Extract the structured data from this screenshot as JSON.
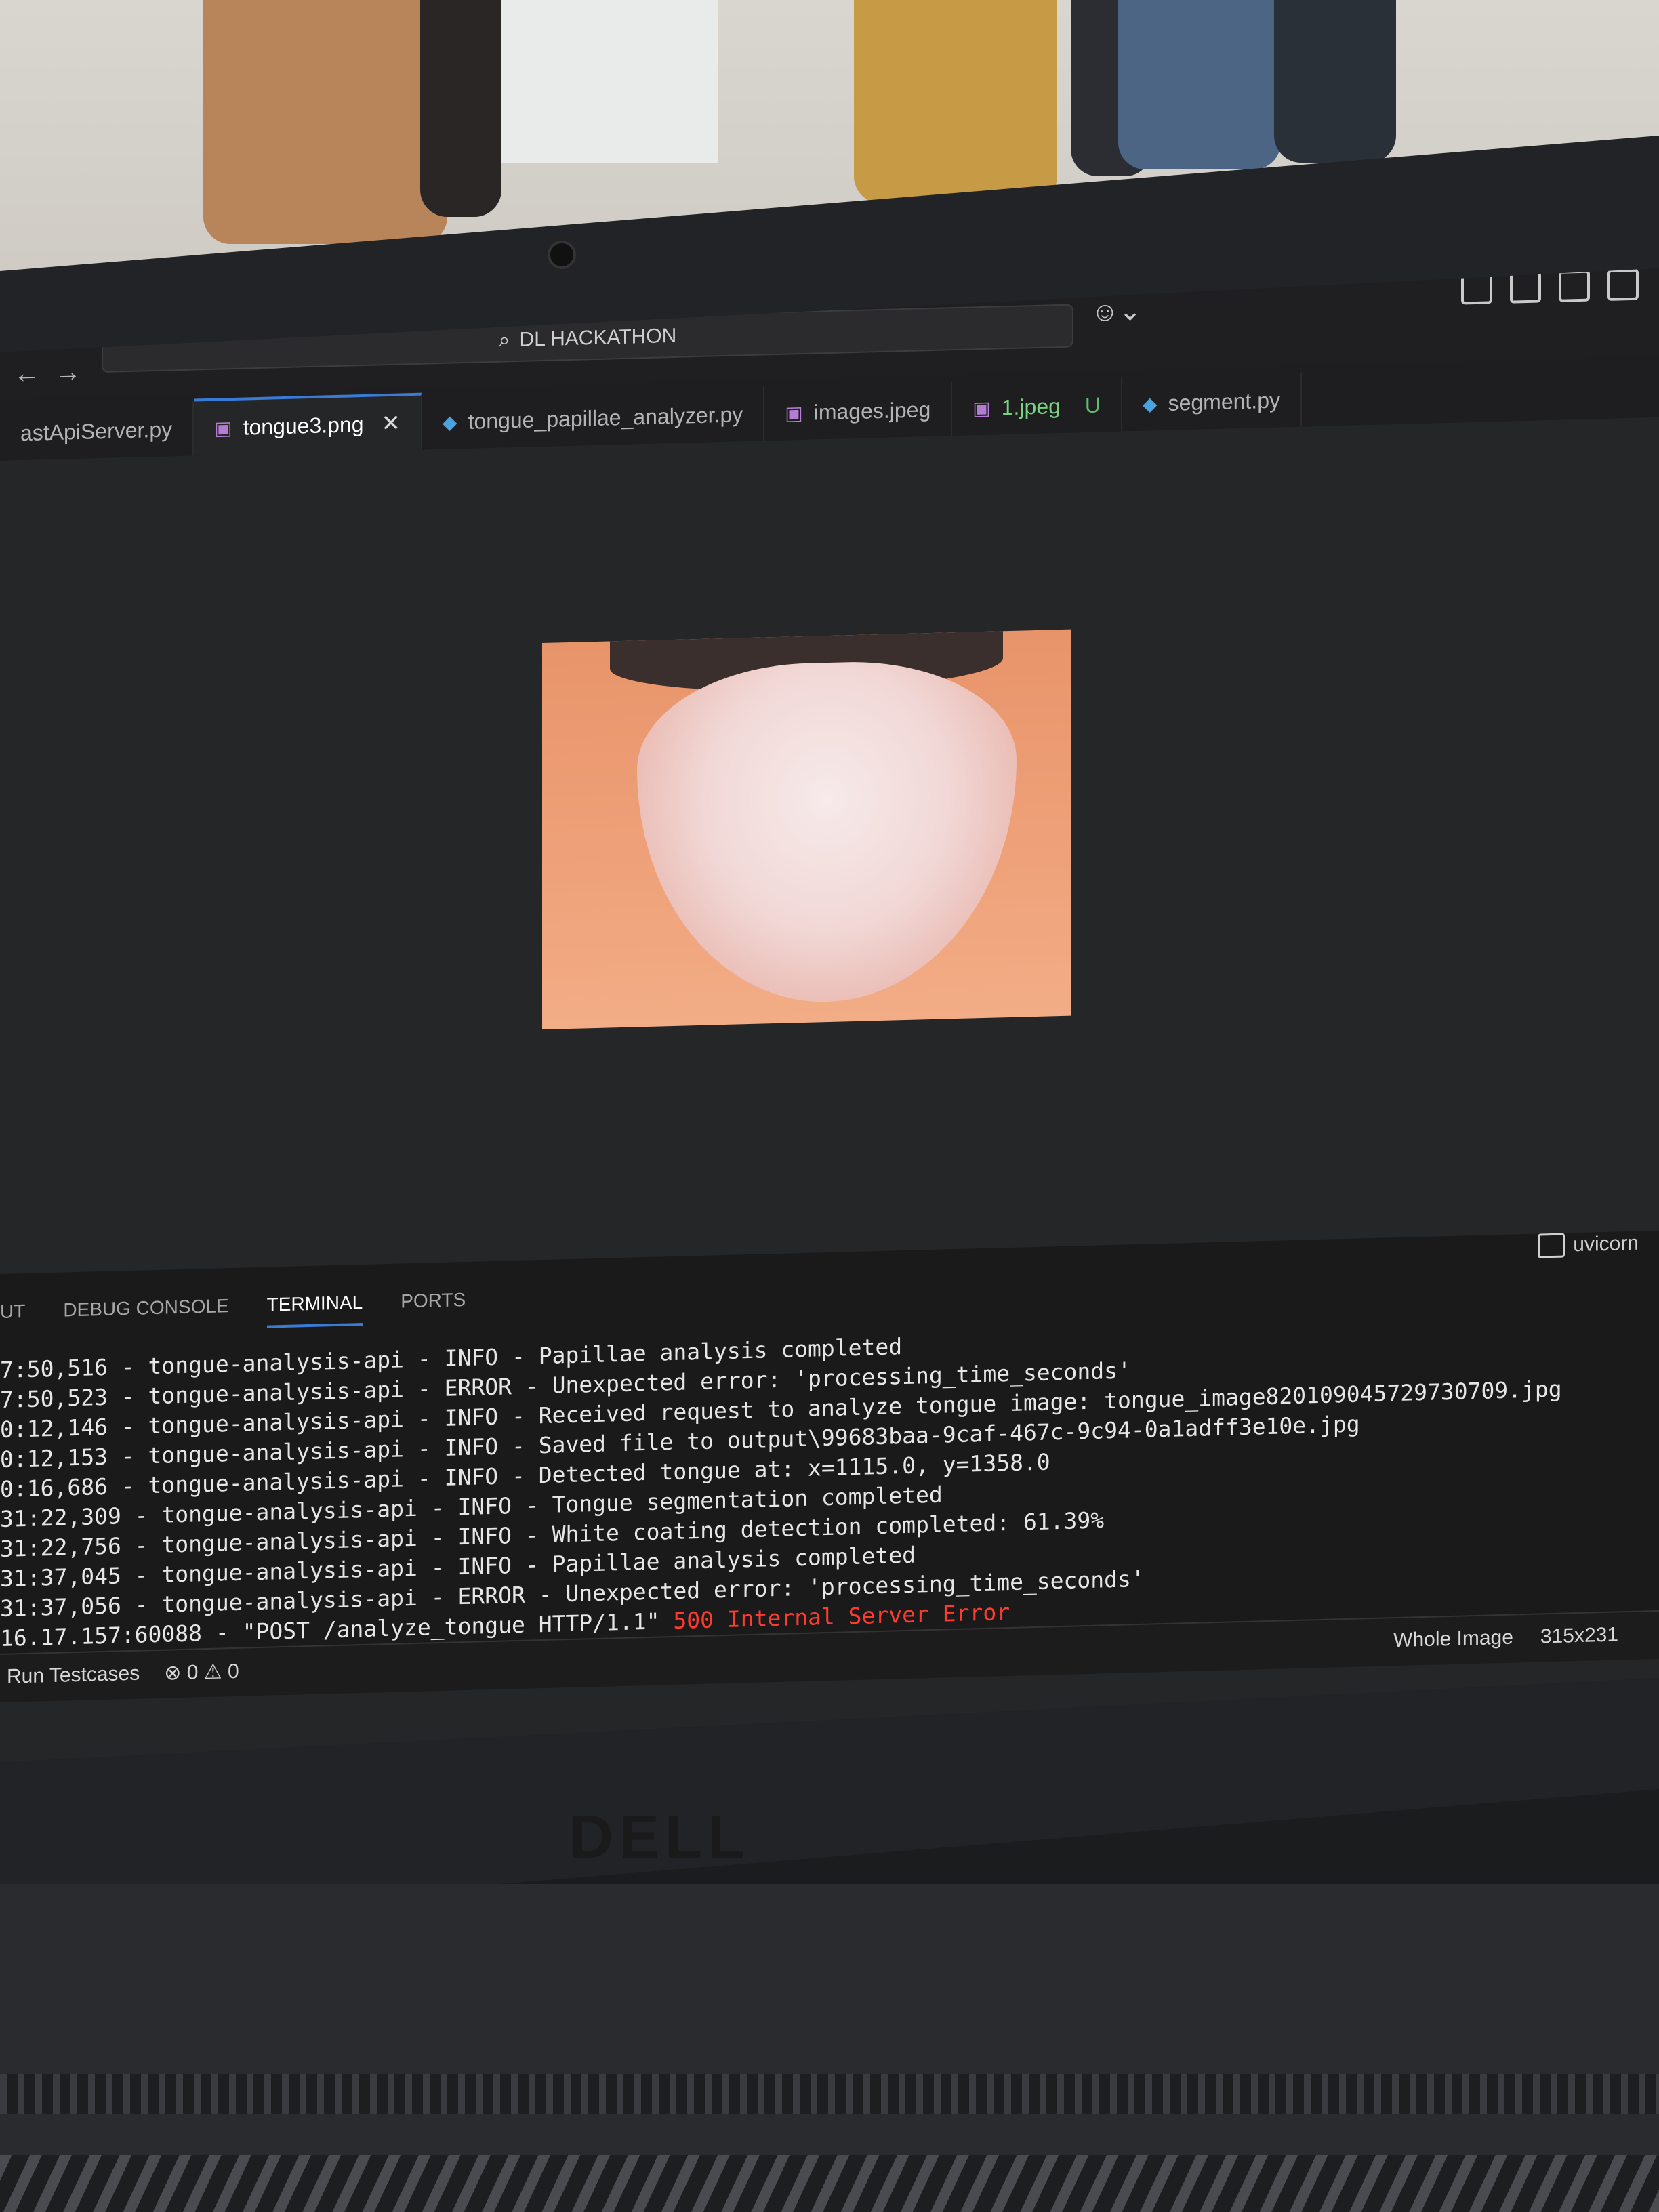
{
  "titlebar": {
    "search_label": "DL HACKATHON"
  },
  "tabs": [
    {
      "label": "astApiServer.py",
      "icon": "python-file-icon"
    },
    {
      "label": "tongue3.png",
      "icon": "image-file-icon",
      "active": true
    },
    {
      "label": "tongue_papillae_analyzer.py",
      "icon": "python-file-icon"
    },
    {
      "label": "images.jpeg",
      "icon": "image-file-icon"
    },
    {
      "label": "1.jpeg",
      "icon": "image-file-icon",
      "badge": "U"
    },
    {
      "label": "segment.py",
      "icon": "python-file-icon"
    }
  ],
  "panel": {
    "tabs": [
      "UT",
      "DEBUG CONSOLE",
      "TERMINAL",
      "PORTS"
    ],
    "active_tab": "TERMINAL",
    "terminal_name": "uvicorn"
  },
  "terminal": {
    "lines": [
      "7:50,516 - tongue-analysis-api - INFO - Papillae analysis completed",
      "7:50,523 - tongue-analysis-api - ERROR - Unexpected error: 'processing_time_seconds'",
      "0:12,146 - tongue-analysis-api - INFO - Received request to analyze tongue image: tongue_image820109045729730709.jpg",
      "0:12,153 - tongue-analysis-api - INFO - Saved file to output\\99683baa-9caf-467c-9c94-0a1adff3e10e.jpg",
      "0:16,686 - tongue-analysis-api - INFO - Detected tongue at: x=1115.0, y=1358.0",
      "31:22,309 - tongue-analysis-api - INFO - Tongue segmentation completed",
      "31:22,756 - tongue-analysis-api - INFO - White coating detection completed: 61.39%",
      "31:37,045 - tongue-analysis-api - INFO - Papillae analysis completed",
      "31:37,056 - tongue-analysis-api - ERROR - Unexpected error: 'processing_time_seconds'"
    ],
    "last_line_prefix": "16.17.157:60088 - \"POST /analyze_tongue HTTP/1.1\" ",
    "last_line_error": "500 Internal Server Error"
  },
  "statusbar": {
    "run_testcases": "Run Testcases",
    "errors": "0",
    "warnings": "0",
    "image_mode": "Whole Image",
    "image_size": "315x231"
  },
  "laptop": {
    "brand": "DELL"
  }
}
